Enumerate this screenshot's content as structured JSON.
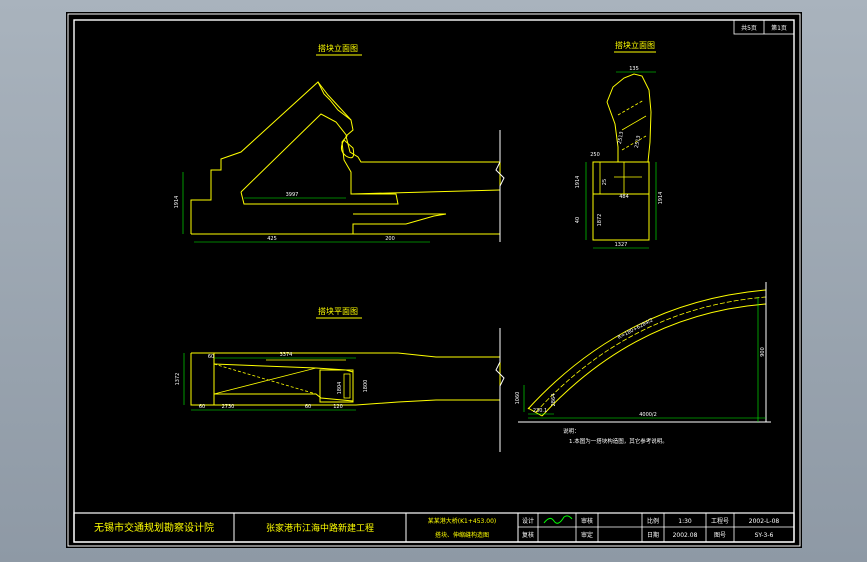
{
  "corner_stamp": [
    "共5页",
    "第1页"
  ],
  "views": {
    "side_elevation_title": "搭块立面图",
    "front_elevation_title": "搭块立面图",
    "plan_title": "搭块平面图"
  },
  "dimensions": {
    "v1_height": "1914",
    "v1_diag": "3997",
    "v1_left": "425",
    "v1_right": "200",
    "v2_top": "135",
    "v2_a": "2513",
    "v2_b": "2513",
    "v2_c": "250",
    "v2_d": "1914",
    "v2_e": "25",
    "v2_f": "40",
    "v2_g": "1872",
    "v2_h": "1327",
    "v2_i": "484",
    "v2_j": "1914",
    "v3_a": "3374",
    "v3_b": "1372",
    "v3_c": "1800",
    "v3_d": "60",
    "v3_e": "2730",
    "v3_f": "60",
    "v3_g": "120",
    "v3_h": "1804",
    "v3_i": "60",
    "v4_radius": "R=180+6284/2",
    "v4_height": "900",
    "v4_a": "1060",
    "v4_b": "2864",
    "v4_c": "230.1",
    "v4_d": "4000/2"
  },
  "notes": {
    "heading": "说明：",
    "line1": "1.本图为一搭块构造图，其它参考说明。"
  },
  "title_block": {
    "org": "无锡市交通规划勘察设计院",
    "project": "张家港市江海中路新建工程",
    "drawing_line1": "某某港大桥(K1+453.00)",
    "drawing_line2": "搭块、伸缩缝构造图",
    "design_label": "设计",
    "review_label": "复核",
    "check_label": "审核",
    "approve_label": "审定",
    "scale_label": "比例",
    "scale_value": "1:30",
    "date_label": "日期",
    "date_value": "2002.08",
    "proj_no_label": "工程号",
    "proj_no_value": "2002-L-08",
    "drawing_no_label": "图号",
    "drawing_no_value": "SY-3-6"
  }
}
